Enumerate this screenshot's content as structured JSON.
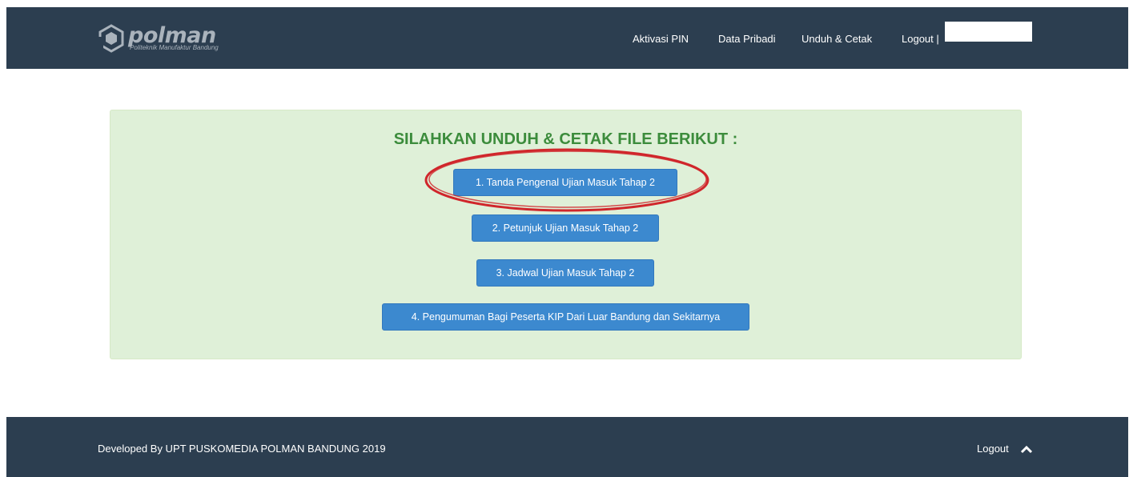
{
  "brand": {
    "name": "polman",
    "subtitle": "Politeknik Manufaktur Bandung",
    "icon": "polman-logo-icon"
  },
  "nav": {
    "items": [
      {
        "label": "Aktivasi PIN"
      },
      {
        "label": "Data Pribadi"
      },
      {
        "label": "Unduh & Cetak"
      },
      {
        "label": "Logout |"
      }
    ]
  },
  "main": {
    "title": "SILAHKAN UNDUH & CETAK FILE BERIKUT :",
    "buttons": [
      {
        "label": "1. Tanda Pengenal Ujian Masuk Tahap 2"
      },
      {
        "label": "2. Petunjuk Ujian Masuk Tahap 2"
      },
      {
        "label": "3. Jadwal Ujian Masuk Tahap 2"
      },
      {
        "label": "4. Pengumuman Bagi Peserta KIP Dari Luar Bandung dan Sekitarnya"
      }
    ],
    "highlight_color": "#d0262b"
  },
  "footer": {
    "credit": "Developed By UPT PUSKOMEDIA POLMAN BANDUNG 2019",
    "logout_label": "Logout",
    "logout_icon": "chevron-up-icon"
  },
  "colors": {
    "navbar": "#2c3e50",
    "panel": "#dff0d8",
    "title": "#3c8c3c",
    "button": "#3c89cf"
  }
}
